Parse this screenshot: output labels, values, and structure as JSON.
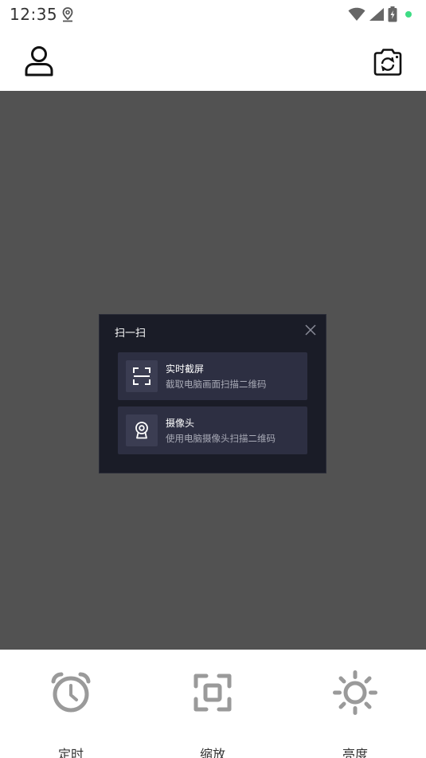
{
  "status_bar": {
    "time": "12:35"
  },
  "top_bar": {
    "user_icon": "user-icon",
    "camera_icon": "camera-rotate-icon"
  },
  "dialog": {
    "title": "扫一扫",
    "options": [
      {
        "title": "实时截屏",
        "subtitle": "截取电脑画面扫描二维码",
        "icon": "scan-frame-icon"
      },
      {
        "title": "摄像头",
        "subtitle": "使用电脑摄像头扫描二维码",
        "icon": "webcam-icon"
      }
    ]
  },
  "bottom_bar": {
    "tools": [
      {
        "label": "定时",
        "icon": "alarm-clock-icon"
      },
      {
        "label": "缩放",
        "icon": "zoom-frame-icon"
      },
      {
        "label": "亮度",
        "icon": "brightness-icon"
      }
    ]
  },
  "colors": {
    "screen_bg": "#525252",
    "dialog_bg": "#1a1c27",
    "option_bg": "#2d2f42",
    "accent_green": "#3ddc84"
  }
}
